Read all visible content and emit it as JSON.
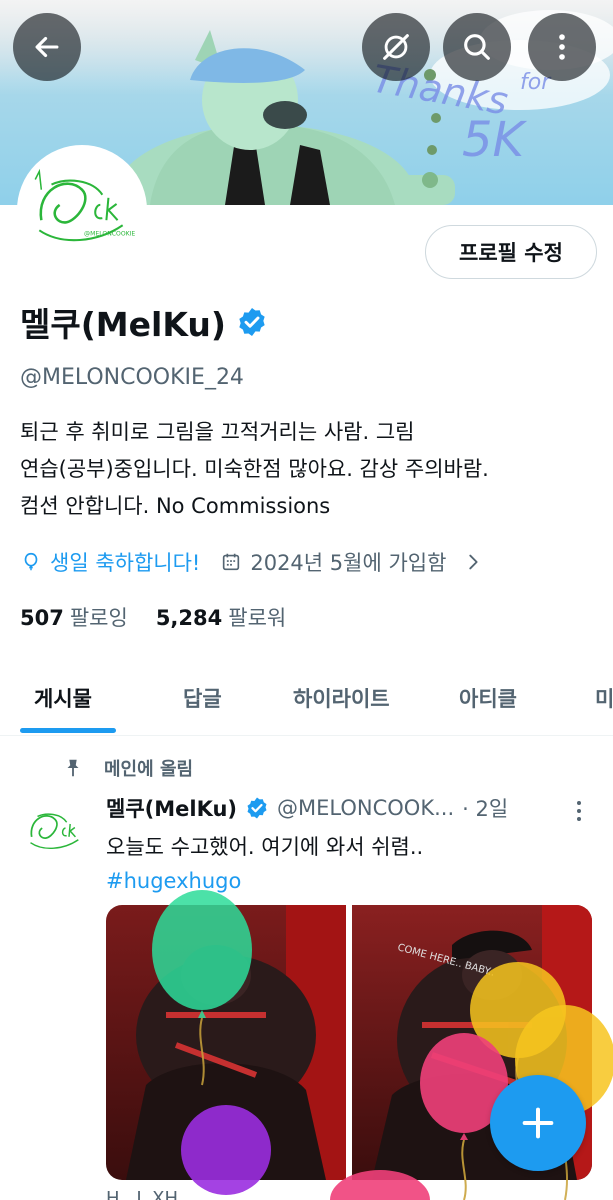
{
  "header": {
    "back_icon": "arrow-left-icon",
    "grok_icon": "slash-circle-icon",
    "search_icon": "search-icon",
    "more_icon": "more-vertical-icon"
  },
  "banner": {
    "text_thanks": "Thanks",
    "text_for": "for",
    "text_5k": "5K"
  },
  "profile": {
    "edit_button": "프로필 수정",
    "display_name": "멜쿠(MelKu)",
    "handle": "@MELONCOOKIE_24",
    "bio_lines": [
      "퇴근 후 취미로 그림을 끄적거리는 사람. 그림",
      "연습(공부)중입니다. 미숙한점 많아요. 감상 주의바람.",
      "컴션 안합니다. No Commissions"
    ],
    "birthday": "생일 축하합니다!",
    "joined": "2024년 5월에 가입함",
    "following_count": "507",
    "following_label": "팔로잉",
    "followers_count": "5,284",
    "followers_label": "팔로워"
  },
  "tabs": [
    {
      "label": "게시물"
    },
    {
      "label": "답글"
    },
    {
      "label": "하이라이트"
    },
    {
      "label": "아티클"
    },
    {
      "label": "미"
    }
  ],
  "post": {
    "pinned_label": "메인에 올림",
    "name": "멜쿠(MelKu)",
    "handle": "@MELONCOOK...",
    "time": "· 2일",
    "text": "오늘도 수고했어. 여기에 와서 쉬렴..",
    "hashtag": "#hugexhugo",
    "media2_caption": "COME HERE.. BABY..",
    "below_text": "H.. L XH ..."
  },
  "colors": {
    "accent": "#1d9bf0",
    "text_primary": "#0f1419",
    "text_secondary": "#536471"
  }
}
